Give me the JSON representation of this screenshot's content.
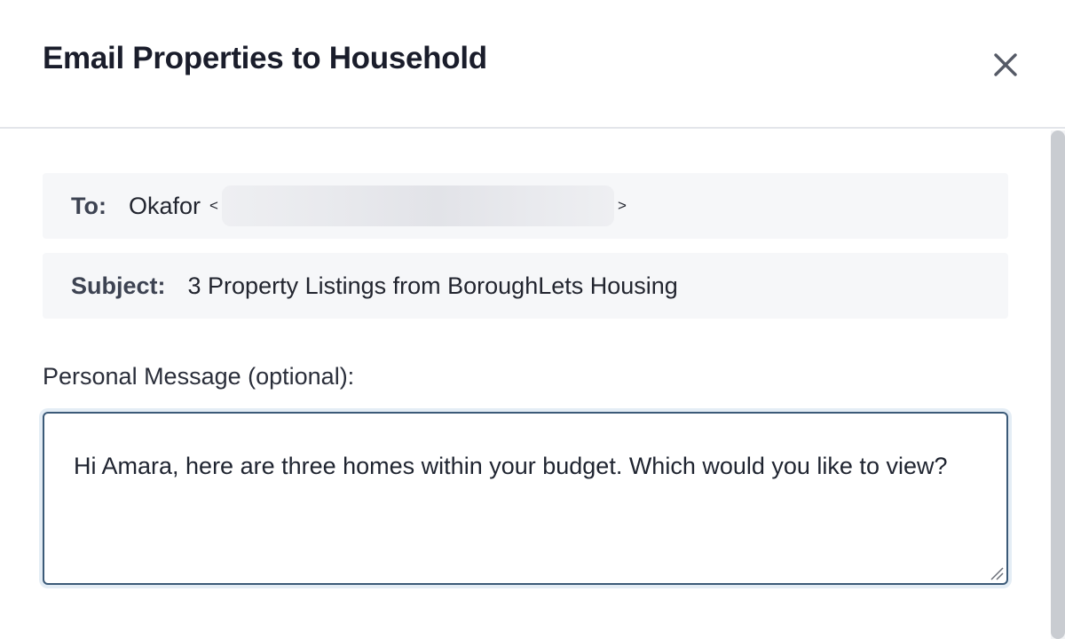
{
  "dialog": {
    "title": "Email Properties to Household",
    "close_icon": "close-icon"
  },
  "to": {
    "label": "To:",
    "name": "Okafor",
    "open_bracket": "<",
    "close_bracket": ">"
  },
  "subject": {
    "label": "Subject:",
    "value": "3 Property Listings from BoroughLets Housing"
  },
  "message": {
    "label": "Personal Message (optional):",
    "value": "Hi Amara, here are three homes within your budget. Which would you like to view?"
  },
  "colors": {
    "focus_border": "#3b5a78",
    "field_background": "#f6f7f9",
    "title_text": "#1a1d2b"
  }
}
